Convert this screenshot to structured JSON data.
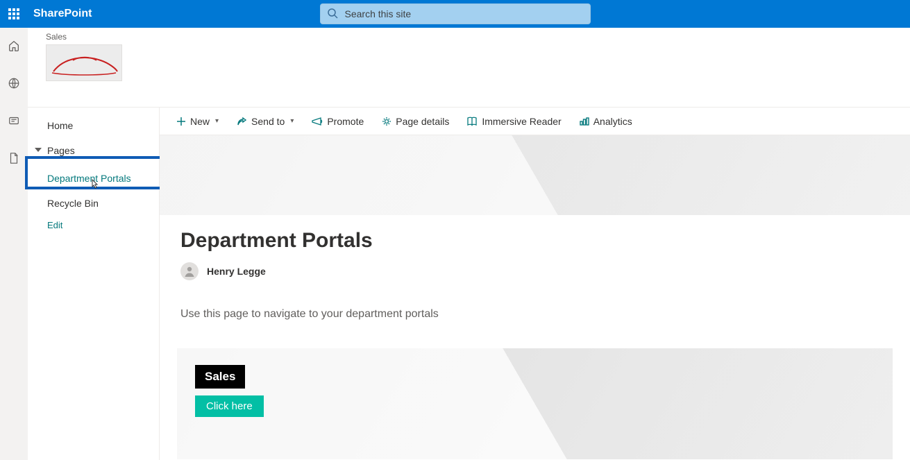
{
  "suite": {
    "brand": "SharePoint",
    "search_placeholder": "Search this site"
  },
  "site": {
    "breadcrumb": "Sales"
  },
  "leftnav": {
    "home": "Home",
    "pages": "Pages",
    "department_portals": "Department Portals",
    "recycle_bin": "Recycle Bin",
    "edit": "Edit"
  },
  "commandbar": {
    "new": "New",
    "send_to": "Send to",
    "promote": "Promote",
    "page_details": "Page details",
    "immersive_reader": "Immersive Reader",
    "analytics": "Analytics"
  },
  "page": {
    "title": "Department Portals",
    "author": "Henry Legge",
    "intro": "Use this page to navigate to your department portals",
    "card": {
      "title": "Sales",
      "button": "Click here"
    }
  }
}
